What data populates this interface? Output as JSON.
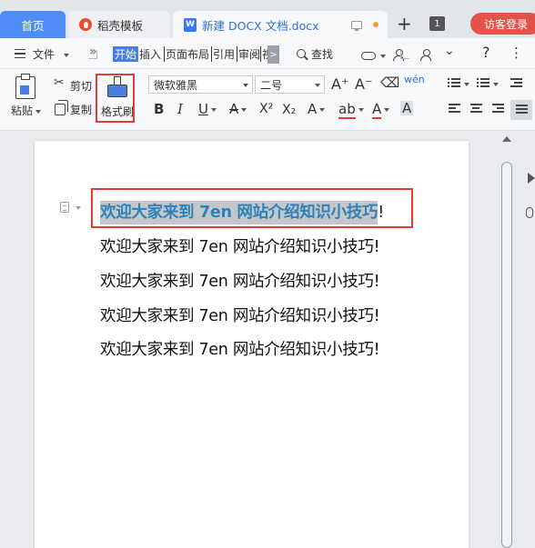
{
  "tabs": {
    "home": "首页",
    "template": "稻壳模板",
    "document": "新建 DOCX 文档.docx",
    "doc_icon_letter": "W",
    "new_tab": "+",
    "window_count": "1",
    "login": "访客登录"
  },
  "menu": {
    "file": "文件",
    "more": "»",
    "tabs": [
      "开始",
      "插入",
      "页面布局",
      "引用",
      "审阅",
      "视"
    ],
    "overflow": ">",
    "search": "查找",
    "help": "?",
    "more_dots": "⋮"
  },
  "toolbar": {
    "paste": "粘贴",
    "cut": "剪切",
    "copy": "复制",
    "format_painter": "格式刷",
    "font_name": "微软雅黑",
    "font_size": "二号",
    "grow_font": "A⁺",
    "shrink_font": "A⁻",
    "bold": "B",
    "italic": "I",
    "underline": "U",
    "strikethrough": "A",
    "superscript": "X²",
    "subscript": "X₂",
    "text_effect": "A",
    "highlight": "ab",
    "font_color": "A",
    "char_shading": "A",
    "pinyin": "wén",
    "accent_color": "#4a7fe0",
    "highlight_frame_color": "#e23b3b"
  },
  "document": {
    "lines": [
      {
        "text": "欢迎大家来到 7en 网站介绍知识小技巧",
        "suffix": "!",
        "selected": true
      },
      {
        "text": "欢迎大家来到 7en 网站介绍知识小技巧!",
        "selected": false
      },
      {
        "text": "欢迎大家来到 7en 网站介绍知识小技巧!",
        "selected": false
      },
      {
        "text": "欢迎大家来到 7en 网站介绍知识小技巧!",
        "selected": false
      },
      {
        "text": "欢迎大家来到 7en 网站介绍知识小技巧!",
        "selected": false
      }
    ],
    "selection_text_color": "#2d82b9",
    "selection_bg_color": "#c4c6c9"
  }
}
